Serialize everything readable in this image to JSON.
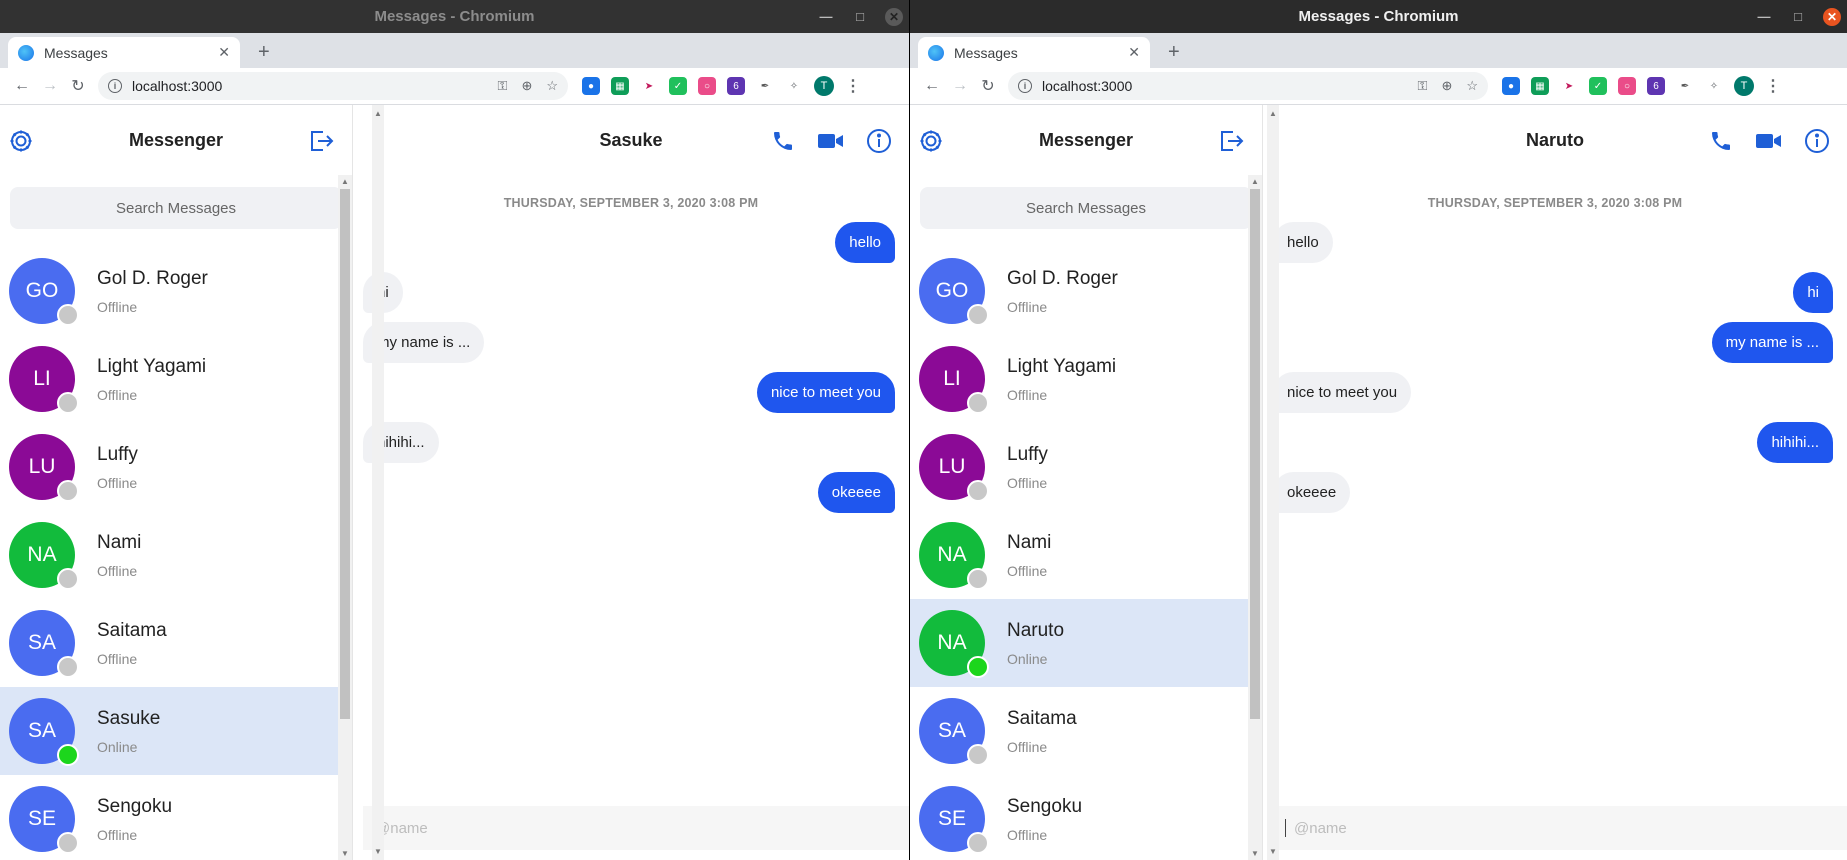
{
  "colors": {
    "accent": "#1f5fd6",
    "bubble_mine": "#1f56ee",
    "bubble_theirs": "#f0f1f4",
    "active_row": "#dce6f7",
    "online": "#1cd61c",
    "offline": "#c8c8c8"
  },
  "windows": [
    {
      "window_title": "Messages - Chromium",
      "tab_title": "Messages",
      "url": "localhost:3000",
      "profile_initial": "T",
      "extension_badge": "6",
      "app": {
        "sidebar_title": "Messenger",
        "search_placeholder": "Search Messages",
        "contacts": [
          {
            "initials": "GO",
            "name": "Gol D. Roger",
            "status": "Offline",
            "color": "#4a6cf0",
            "online": false,
            "active": false
          },
          {
            "initials": "LI",
            "name": "Light Yagami",
            "status": "Offline",
            "color": "#8b0a96",
            "online": false,
            "active": false
          },
          {
            "initials": "LU",
            "name": "Luffy",
            "status": "Offline",
            "color": "#8b0a96",
            "online": false,
            "active": false
          },
          {
            "initials": "NA",
            "name": "Nami",
            "status": "Offline",
            "color": "#12bb3c",
            "online": false,
            "active": false
          },
          {
            "initials": "SA",
            "name": "Saitama",
            "status": "Offline",
            "color": "#4a6cf0",
            "online": false,
            "active": false
          },
          {
            "initials": "SA",
            "name": "Sasuke",
            "status": "Online",
            "color": "#4a6cf0",
            "online": true,
            "active": true
          },
          {
            "initials": "SE",
            "name": "Sengoku",
            "status": "Offline",
            "color": "#4a6cf0",
            "online": false,
            "active": false
          }
        ],
        "chat_title": "Sasuke",
        "chat_date": "THURSDAY, SEPTEMBER 3, 2020 3:08 PM",
        "messages": [
          {
            "text": "hello",
            "mine": true
          },
          {
            "text": "hi",
            "mine": false
          },
          {
            "text": "my name is ...",
            "mine": false
          },
          {
            "text": "nice to meet you",
            "mine": true
          },
          {
            "text": "hihihi...",
            "mine": false
          },
          {
            "text": "okeeee",
            "mine": true
          }
        ],
        "composer_placeholder": "@name"
      }
    },
    {
      "window_title": "Messages - Chromium",
      "tab_title": "Messages",
      "url": "localhost:3000",
      "profile_initial": "T",
      "extension_badge": "6",
      "app": {
        "sidebar_title": "Messenger",
        "search_placeholder": "Search Messages",
        "contacts": [
          {
            "initials": "GO",
            "name": "Gol D. Roger",
            "status": "Offline",
            "color": "#4a6cf0",
            "online": false,
            "active": false
          },
          {
            "initials": "LI",
            "name": "Light Yagami",
            "status": "Offline",
            "color": "#8b0a96",
            "online": false,
            "active": false
          },
          {
            "initials": "LU",
            "name": "Luffy",
            "status": "Offline",
            "color": "#8b0a96",
            "online": false,
            "active": false
          },
          {
            "initials": "NA",
            "name": "Nami",
            "status": "Offline",
            "color": "#12bb3c",
            "online": false,
            "active": false
          },
          {
            "initials": "NA",
            "name": "Naruto",
            "status": "Online",
            "color": "#12bb3c",
            "online": true,
            "active": true
          },
          {
            "initials": "SA",
            "name": "Saitama",
            "status": "Offline",
            "color": "#4a6cf0",
            "online": false,
            "active": false
          },
          {
            "initials": "SE",
            "name": "Sengoku",
            "status": "Offline",
            "color": "#4a6cf0",
            "online": false,
            "active": false
          }
        ],
        "chat_title": "Naruto",
        "chat_date": "THURSDAY, SEPTEMBER 3, 2020 3:08 PM",
        "messages": [
          {
            "text": "hello",
            "mine": false
          },
          {
            "text": "hi",
            "mine": true
          },
          {
            "text": "my name is ...",
            "mine": true
          },
          {
            "text": "nice to meet you",
            "mine": false
          },
          {
            "text": "hihihi...",
            "mine": true
          },
          {
            "text": "okeeee",
            "mine": false
          }
        ],
        "composer_placeholder": "@name"
      }
    }
  ]
}
